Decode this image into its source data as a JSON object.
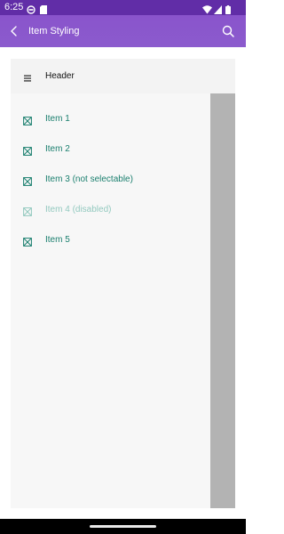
{
  "status_bar": {
    "time": "6:25",
    "icons": [
      "vpn-icon",
      "sim-card-icon",
      "wifi-icon",
      "signal-icon",
      "battery-icon"
    ]
  },
  "app_bar": {
    "title": "Item Styling",
    "back_icon": "back-arrow-icon",
    "search_icon": "search-icon",
    "color": "#8a54cc"
  },
  "list": {
    "header": {
      "label": "Header",
      "icon": "hamburger-menu-icon"
    },
    "items": [
      {
        "label": "Item 1",
        "icon": "checkbox-cross-icon",
        "enabled": true
      },
      {
        "label": "Item 2",
        "icon": "checkbox-cross-icon",
        "enabled": true
      },
      {
        "label": "Item 3 (not selectable)",
        "icon": "checkbox-cross-icon",
        "enabled": true
      },
      {
        "label": "Item 4 (disabled)",
        "icon": "checkbox-cross-icon",
        "enabled": false
      },
      {
        "label": "Item 5",
        "icon": "checkbox-cross-icon",
        "enabled": true
      }
    ],
    "colors": {
      "item": "#1a7f6e",
      "disabled": "#93c9bf"
    }
  }
}
